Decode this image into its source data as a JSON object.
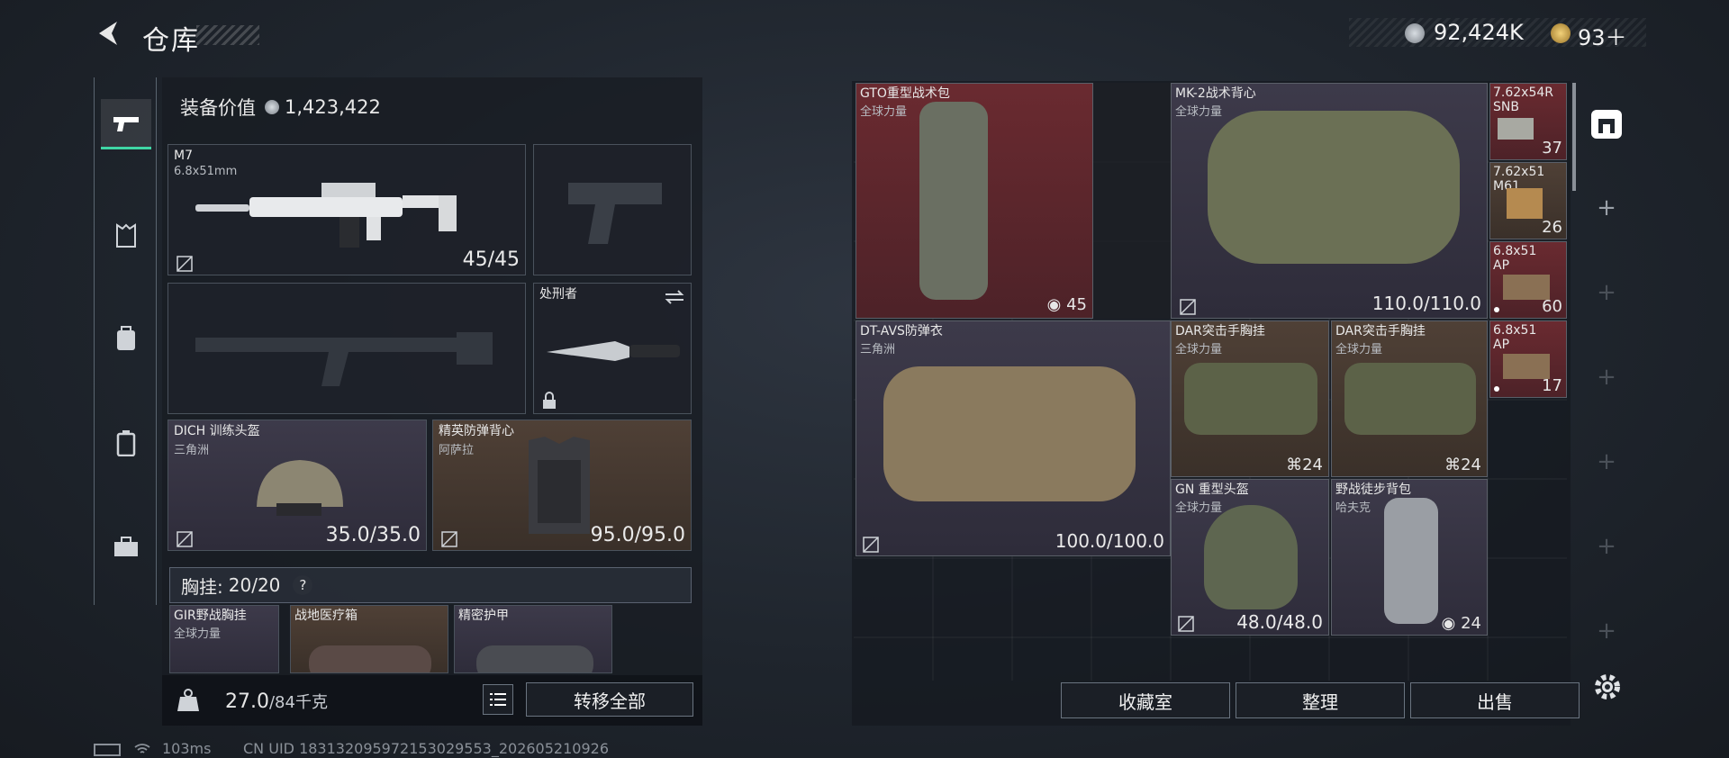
{
  "header": {
    "title": "仓库",
    "currency_silver": "92,424K",
    "currency_gold": "93＋"
  },
  "equipment": {
    "label": "装备价值",
    "value": "1,423,422"
  },
  "weapon": {
    "name": "M7",
    "caliber": "6.8x51mm",
    "ammo": "45/45"
  },
  "melee": {
    "name": "处刑者"
  },
  "helmet": {
    "name": "DICH 训练头盔",
    "faction": "三角洲",
    "durability": "35.0/35.0"
  },
  "armor": {
    "name": "精英防弹背心",
    "faction": "阿萨拉",
    "durability": "95.0/95.0"
  },
  "chest": {
    "label": "胸挂:",
    "count": "20/20",
    "help": "?"
  },
  "chest_items": [
    {
      "name": "GIR野战胸挂",
      "faction": "全球力量"
    },
    {
      "name": "战地医疗箱",
      "faction": ""
    },
    {
      "name": "精密护甲",
      "faction": ""
    }
  ],
  "weight": {
    "current": "27.0",
    "max": "/84千克"
  },
  "buttons": {
    "transfer_all": "转移全部",
    "collection": "收藏室",
    "organize": "整理",
    "sell": "出售"
  },
  "grid_items": [
    {
      "name": "GTO重型战术包",
      "faction": "全球力量",
      "value": "45"
    },
    {
      "name": "MK-2战术背心",
      "faction": "全球力量",
      "value": "110.0/110.0"
    },
    {
      "name": "7.62x54R",
      "faction": "SNB",
      "value": "37"
    },
    {
      "name": "7.62x51",
      "faction": "M61",
      "value": "26"
    },
    {
      "name": "6.8x51",
      "faction": "AP",
      "value": "60"
    },
    {
      "name": "6.8x51",
      "faction": "AP",
      "value": "17"
    },
    {
      "name": "DT-AVS防弹衣",
      "faction": "三角洲",
      "value": "100.0/100.0"
    },
    {
      "name": "DAR突击手胸挂",
      "faction": "全球力量",
      "value": "24"
    },
    {
      "name": "DAR突击手胸挂",
      "faction": "全球力量",
      "value": "24"
    },
    {
      "name": "GN 重型头盔",
      "faction": "全球力量",
      "value": "48.0/48.0"
    },
    {
      "name": "野战徒步背包",
      "faction": "哈夫克",
      "value": "24"
    }
  ],
  "status": {
    "ping": "103ms",
    "uid": "CN UID 1831320959721530​29553_202605210926"
  },
  "colors": {
    "accent": "#3fd6a5",
    "rare_red": "#6a2a30",
    "brown": "#4f4036",
    "purple": "#3d3a4a"
  },
  "icons": [
    "back-arrow-icon",
    "silver-coin-icon",
    "gold-coin-icon",
    "pistol-icon",
    "vest-icon",
    "backpack-icon",
    "case-icon",
    "toolbox-icon",
    "weight-icon",
    "list-icon",
    "safe-icon",
    "plus-icon",
    "gear-icon",
    "battery-icon",
    "wifi-icon"
  ]
}
